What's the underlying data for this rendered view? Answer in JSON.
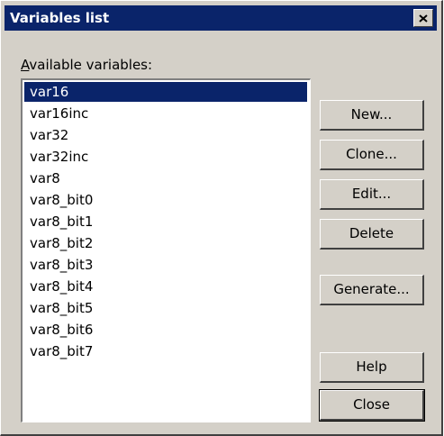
{
  "window": {
    "title": "Variables list"
  },
  "label": {
    "available_prefix": "A",
    "available_rest": "vailable variables:"
  },
  "variables": [
    "var16",
    "var16inc",
    "var32",
    "var32inc",
    "var8",
    "var8_bit0",
    "var8_bit1",
    "var8_bit2",
    "var8_bit3",
    "var8_bit4",
    "var8_bit5",
    "var8_bit6",
    "var8_bit7"
  ],
  "selected_index": 0,
  "buttons": {
    "new": {
      "u": "N",
      "rest": "ew..."
    },
    "clone": {
      "u": "C",
      "rest": "lone..."
    },
    "edit": {
      "u": "E",
      "rest": "dit..."
    },
    "delete": {
      "u": "D",
      "rest": "elete"
    },
    "generate": {
      "u": "G",
      "rest": "enerate..."
    },
    "help": {
      "u": "H",
      "rest": "elp"
    },
    "close": {
      "label": "Close"
    }
  },
  "icons": {
    "close": "close-x-icon"
  }
}
